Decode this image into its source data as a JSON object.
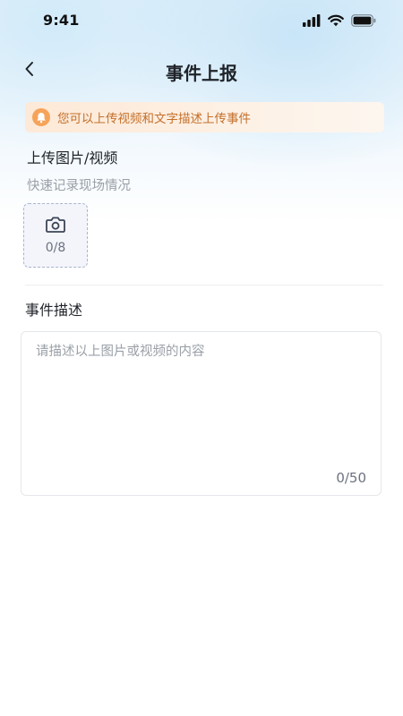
{
  "status_bar": {
    "time": "9:41"
  },
  "header": {
    "title": "事件上报"
  },
  "notice": {
    "text": "您可以上传视频和文字描述上传事件"
  },
  "upload": {
    "title": "上传图片/视频",
    "subtitle": "快速记录现场情况",
    "count": "0/8",
    "icon": "camera-icon"
  },
  "description": {
    "title": "事件描述",
    "placeholder": "请描述以上图片或视频的内容",
    "count": "0/50"
  },
  "colors": {
    "notice_text": "#c4702b",
    "notice_icon": "#f6a35a",
    "upload_border": "#a9b4cf",
    "muted_text": "#9aa0a8"
  }
}
